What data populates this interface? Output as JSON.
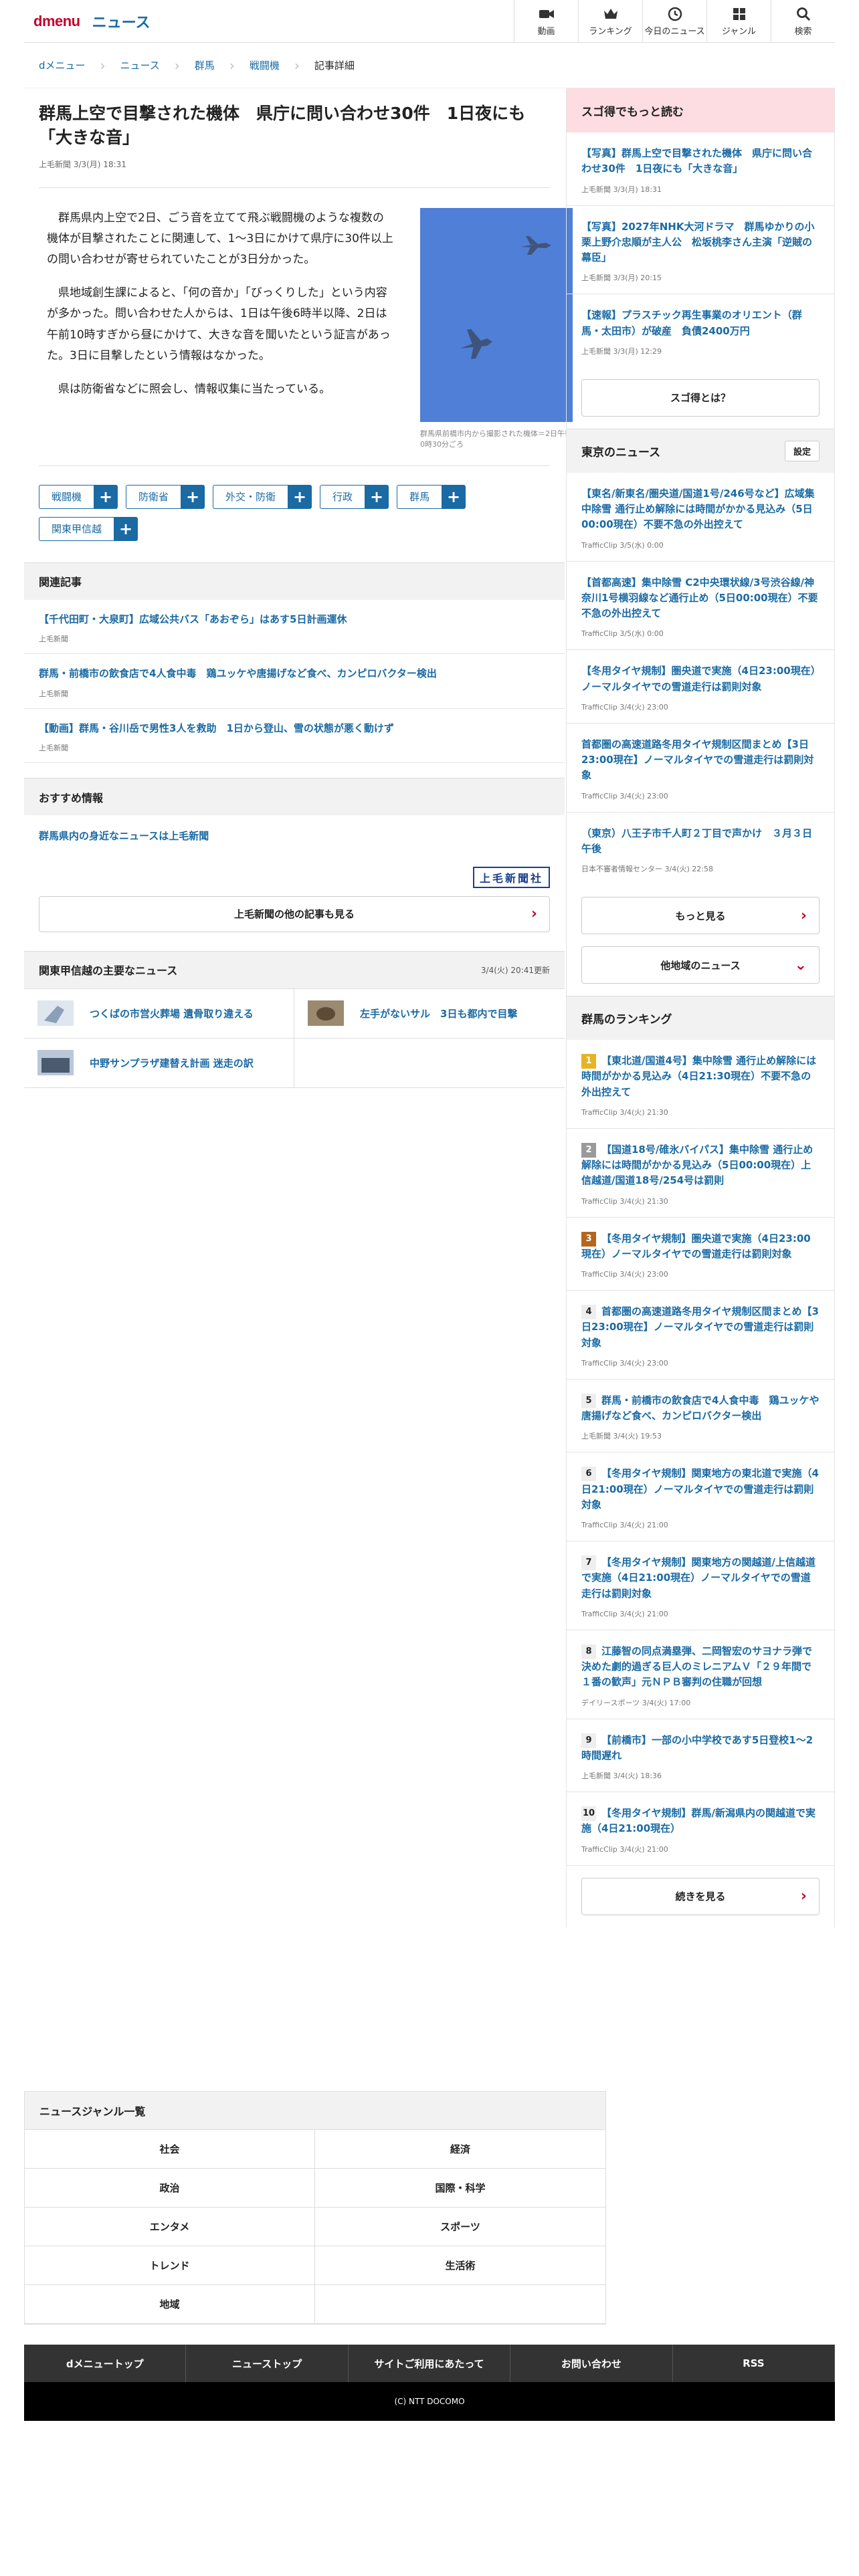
{
  "header": {
    "logo": "dmenu",
    "section": "ニュース",
    "nav": [
      "動画",
      "ランキング",
      "今日のニュース",
      "ジャンル",
      "検索"
    ]
  },
  "breadcrumb": [
    "dメニュー",
    "ニュース",
    "群馬",
    "戦闘機",
    "記事詳細"
  ],
  "article": {
    "title": "群馬上空で目撃された機体　県庁に問い合わせ30件　1日夜にも「大きな音」",
    "meta": "上毛新聞 3/3(月) 18:31",
    "paragraphs": [
      "群馬県内上空で2日、ごう音を立てて飛ぶ戦闘機のような複数の機体が目撃されたことに関連して、1～3日にかけて県庁に30件以上の問い合わせが寄せられていたことが3日分かった。",
      "県地域創生課によると、「何の音か」「びっくりした」という内容が多かった。問い合わせた人からは、1日は午後6時半以降、2日は午前10時すぎから昼にかけて、大きな音を聞いたという証言があった。3日に目撃したという情報はなかった。",
      "県は防衛省などに照会し、情報収集に当たっている。"
    ],
    "photo_caption": "群馬県前橋市内から撮影された機体＝2日午後0時30分ごろ",
    "tags": [
      "戦闘機",
      "防衛省",
      "外交・防衛",
      "行政",
      "群馬",
      "関東甲信越"
    ]
  },
  "related": {
    "heading": "関連記事",
    "items": [
      {
        "title": "【千代田町・大泉町】広域公共バス「あおぞら」はあす5日計画運休",
        "meta": "上毛新聞"
      },
      {
        "title": "群馬・前橋市の飲食店で4人食中毒　鶏ユッケや唐揚げなど食べ、カンピロバクター検出",
        "meta": "上毛新聞"
      },
      {
        "title": "【動画】群馬・谷川岳で男性3人を救助　1日から登山、雪の状態が悪く動けず",
        "meta": "上毛新聞"
      }
    ]
  },
  "recommend": {
    "heading": "おすすめ情報",
    "link": "群馬県内の身近なニュースは上毛新聞",
    "logo": "上毛新聞社",
    "more": "上毛新聞の他の記事も見る"
  },
  "major": {
    "heading": "関東甲信越の主要なニュース",
    "updated": "3/4(火) 20:41更新",
    "items": [
      "つくばの市営火葬場 遺骨取り違える",
      "左手がないサル　3日も都内で目撃",
      "中野サンプラザ建替え計画 迷走の訳"
    ]
  },
  "sugotoku": {
    "heading": "スゴ得でもっと読む",
    "items": [
      {
        "title": "【写真】群馬上空で目撃された機体　県庁に問い合わせ30件　1日夜にも「大きな音」",
        "meta": "上毛新聞 3/3(月) 18:31"
      },
      {
        "title": "【写真】2027年NHK大河ドラマ　群馬ゆかりの小栗上野介忠順が主人公　松坂桃李さん主演「逆賊の幕臣」",
        "meta": "上毛新聞 3/3(月) 20:15"
      },
      {
        "title": "【速報】プラスチック再生事業のオリエント（群馬・太田市）が破産　負債2400万円",
        "meta": "上毛新聞 3/3(月) 12:29"
      }
    ],
    "button": "スゴ得とは？"
  },
  "tokyo": {
    "heading": "東京のニュース",
    "setting": "設定",
    "items": [
      {
        "title": "【東名/新東名/圏央道/国道1号/246号など】広域集中除雪 通行止め解除には時間がかかる見込み（5日00:00現在）不要不急の外出控えて",
        "meta": "TrafficClip 3/5(水) 0:00"
      },
      {
        "title": "【首都高速】集中除雪 C2中央環状線/3号渋谷線/神奈川1号横羽線など通行止め（5日00:00現在）不要不急の外出控えて",
        "meta": "TrafficClip 3/5(水) 0:00"
      },
      {
        "title": "【冬用タイヤ規制】圏央道で実施（4日23:00現在）ノーマルタイヤでの雪道走行は罰則対象",
        "meta": "TrafficClip 3/4(火) 23:00"
      },
      {
        "title": "首都圏の高速道路冬用タイヤ規制区間まとめ【3日23:00現在】ノーマルタイヤでの雪道走行は罰則対象",
        "meta": "TrafficClip 3/4(火) 23:00"
      },
      {
        "title": "（東京）八王子市千人町２丁目で声かけ　３月３日午後",
        "meta": "日本不審者情報センター 3/4(火) 22:58"
      }
    ],
    "more": "もっと見る",
    "other": "他地域のニュース"
  },
  "ranking": {
    "heading": "群馬のランキング",
    "items": [
      {
        "rank": "1",
        "color": "#e6b422",
        "title": "【東北道/国道4号】集中除雪 通行止め解除には時間がかかる見込み（4日21:30現在）不要不急の外出控えて",
        "meta": "TrafficClip 3/4(火) 21:30"
      },
      {
        "rank": "2",
        "color": "#9a9a9a",
        "title": "【国道18号/碓氷バイパス】集中除雪 通行止め解除には時間がかかる見込み（5日00:00現在）上信越道/国道18号/254号は罰則",
        "meta": "TrafficClip 3/4(火) 21:30"
      },
      {
        "rank": "3",
        "color": "#b5651d",
        "title": "【冬用タイヤ規制】圏央道で実施（4日23:00現在）ノーマルタイヤでの雪道走行は罰則対象",
        "meta": "TrafficClip 3/4(火) 23:00"
      },
      {
        "rank": "4",
        "color": "",
        "title": "首都圏の高速道路冬用タイヤ規制区間まとめ【3日23:00現在】ノーマルタイヤでの雪道走行は罰則対象",
        "meta": "TrafficClip 3/4(火) 23:00"
      },
      {
        "rank": "5",
        "color": "",
        "title": "群馬・前橋市の飲食店で4人食中毒　鶏ユッケや唐揚げなど食べ、カンピロバクター検出",
        "meta": "上毛新聞 3/4(火) 19:53"
      },
      {
        "rank": "6",
        "color": "",
        "title": "【冬用タイヤ規制】関東地方の東北道で実施（4日21:00現在）ノーマルタイヤでの雪道走行は罰則対象",
        "meta": "TrafficClip 3/4(火) 21:00"
      },
      {
        "rank": "7",
        "color": "",
        "title": "【冬用タイヤ規制】関東地方の関越道/上信越道で実施（4日21:00現在）ノーマルタイヤでの雪道走行は罰則対象",
        "meta": "TrafficClip 3/4(火) 21:00"
      },
      {
        "rank": "8",
        "color": "",
        "title": "江藤智の同点満塁弾、二岡智宏のサヨナラ弾で決めた劇的過ぎる巨人のミレニアムＶ「２９年間で１番の歓声」元ＮＰＢ審判の住職が回想",
        "meta": "デイリースポーツ 3/4(火) 17:00"
      },
      {
        "rank": "9",
        "color": "",
        "title": "【前橋市】一部の小中学校であす5日登校1～2時間遅れ",
        "meta": "上毛新聞 3/4(火) 18:36"
      },
      {
        "rank": "10",
        "color": "",
        "title": "【冬用タイヤ規制】群馬/新潟県内の関越道で実施（4日21:00現在）",
        "meta": "TrafficClip 3/4(火) 21:00"
      }
    ],
    "more": "続きを見る"
  },
  "genres": {
    "heading": "ニュースジャンル一覧",
    "items": [
      "社会",
      "経済",
      "政治",
      "国際・科学",
      "エンタメ",
      "スポーツ",
      "トレンド",
      "生活術",
      "地域",
      ""
    ]
  },
  "footer": {
    "links": [
      "dメニュートップ",
      "ニューストップ",
      "サイトご利用にあたって",
      "お問い合わせ",
      "RSS"
    ],
    "copyright": "(C) NTT DOCOMO"
  }
}
